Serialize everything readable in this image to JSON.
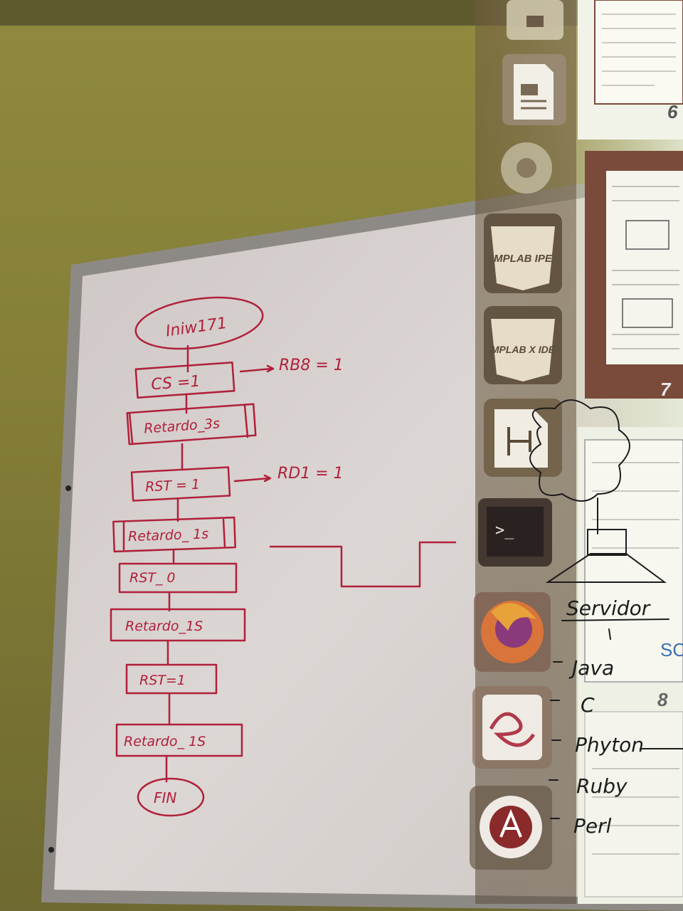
{
  "flowchart": {
    "start": "Iniw171",
    "steps": [
      "CS =1",
      "Retardo_3s",
      "RST = 1",
      "Retardo_ 1s",
      "RST_ 0",
      "Retardo_1S",
      "RST=1",
      "Retardo_ 1S"
    ],
    "end": "FIN",
    "side_notes": [
      "RB8 = 1",
      "RD1 = 1"
    ]
  },
  "projection": {
    "launcher_icons": [
      {
        "name": "archive-icon",
        "label": ""
      },
      {
        "name": "document-viewer-icon",
        "label": ""
      },
      {
        "name": "settings-icon",
        "label": ""
      },
      {
        "name": "mplab-ipe-icon",
        "label": "MPLAB IPE"
      },
      {
        "name": "mplab-xide-icon",
        "label": "MPLAB X IDE"
      },
      {
        "name": "circuit-editor-icon",
        "label": ""
      },
      {
        "name": "terminal-icon",
        "label": ">_"
      },
      {
        "name": "firefox-icon",
        "label": ""
      },
      {
        "name": "e-app-icon",
        "label": ""
      },
      {
        "name": "software-updater-icon",
        "label": ""
      }
    ],
    "page_numbers": [
      "6",
      "7",
      "8"
    ],
    "partial_text": "SC"
  },
  "tree_diagram": {
    "root": "Servidor",
    "items": [
      "Java",
      "C",
      "Phyton",
      "Ruby",
      "Perl"
    ]
  },
  "colors": {
    "marker_red": "#b0203a",
    "marker_black": "#1c1c1c",
    "board": "#d8d2cf",
    "wall": "#8a843a"
  }
}
